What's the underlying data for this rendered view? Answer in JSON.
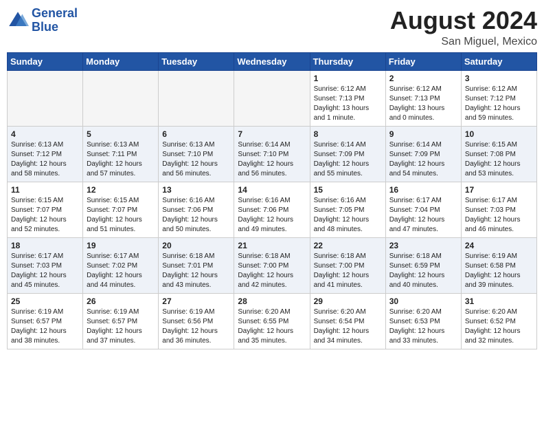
{
  "header": {
    "logo_line1": "General",
    "logo_line2": "Blue",
    "month_year": "August 2024",
    "location": "San Miguel, Mexico"
  },
  "weekdays": [
    "Sunday",
    "Monday",
    "Tuesday",
    "Wednesday",
    "Thursday",
    "Friday",
    "Saturday"
  ],
  "weeks": [
    [
      {
        "day": "",
        "content": ""
      },
      {
        "day": "",
        "content": ""
      },
      {
        "day": "",
        "content": ""
      },
      {
        "day": "",
        "content": ""
      },
      {
        "day": "1",
        "content": "Sunrise: 6:12 AM\nSunset: 7:13 PM\nDaylight: 13 hours\nand 1 minute."
      },
      {
        "day": "2",
        "content": "Sunrise: 6:12 AM\nSunset: 7:13 PM\nDaylight: 13 hours\nand 0 minutes."
      },
      {
        "day": "3",
        "content": "Sunrise: 6:12 AM\nSunset: 7:12 PM\nDaylight: 12 hours\nand 59 minutes."
      }
    ],
    [
      {
        "day": "4",
        "content": "Sunrise: 6:13 AM\nSunset: 7:12 PM\nDaylight: 12 hours\nand 58 minutes."
      },
      {
        "day": "5",
        "content": "Sunrise: 6:13 AM\nSunset: 7:11 PM\nDaylight: 12 hours\nand 57 minutes."
      },
      {
        "day": "6",
        "content": "Sunrise: 6:13 AM\nSunset: 7:10 PM\nDaylight: 12 hours\nand 56 minutes."
      },
      {
        "day": "7",
        "content": "Sunrise: 6:14 AM\nSunset: 7:10 PM\nDaylight: 12 hours\nand 56 minutes."
      },
      {
        "day": "8",
        "content": "Sunrise: 6:14 AM\nSunset: 7:09 PM\nDaylight: 12 hours\nand 55 minutes."
      },
      {
        "day": "9",
        "content": "Sunrise: 6:14 AM\nSunset: 7:09 PM\nDaylight: 12 hours\nand 54 minutes."
      },
      {
        "day": "10",
        "content": "Sunrise: 6:15 AM\nSunset: 7:08 PM\nDaylight: 12 hours\nand 53 minutes."
      }
    ],
    [
      {
        "day": "11",
        "content": "Sunrise: 6:15 AM\nSunset: 7:07 PM\nDaylight: 12 hours\nand 52 minutes."
      },
      {
        "day": "12",
        "content": "Sunrise: 6:15 AM\nSunset: 7:07 PM\nDaylight: 12 hours\nand 51 minutes."
      },
      {
        "day": "13",
        "content": "Sunrise: 6:16 AM\nSunset: 7:06 PM\nDaylight: 12 hours\nand 50 minutes."
      },
      {
        "day": "14",
        "content": "Sunrise: 6:16 AM\nSunset: 7:06 PM\nDaylight: 12 hours\nand 49 minutes."
      },
      {
        "day": "15",
        "content": "Sunrise: 6:16 AM\nSunset: 7:05 PM\nDaylight: 12 hours\nand 48 minutes."
      },
      {
        "day": "16",
        "content": "Sunrise: 6:17 AM\nSunset: 7:04 PM\nDaylight: 12 hours\nand 47 minutes."
      },
      {
        "day": "17",
        "content": "Sunrise: 6:17 AM\nSunset: 7:03 PM\nDaylight: 12 hours\nand 46 minutes."
      }
    ],
    [
      {
        "day": "18",
        "content": "Sunrise: 6:17 AM\nSunset: 7:03 PM\nDaylight: 12 hours\nand 45 minutes."
      },
      {
        "day": "19",
        "content": "Sunrise: 6:17 AM\nSunset: 7:02 PM\nDaylight: 12 hours\nand 44 minutes."
      },
      {
        "day": "20",
        "content": "Sunrise: 6:18 AM\nSunset: 7:01 PM\nDaylight: 12 hours\nand 43 minutes."
      },
      {
        "day": "21",
        "content": "Sunrise: 6:18 AM\nSunset: 7:00 PM\nDaylight: 12 hours\nand 42 minutes."
      },
      {
        "day": "22",
        "content": "Sunrise: 6:18 AM\nSunset: 7:00 PM\nDaylight: 12 hours\nand 41 minutes."
      },
      {
        "day": "23",
        "content": "Sunrise: 6:18 AM\nSunset: 6:59 PM\nDaylight: 12 hours\nand 40 minutes."
      },
      {
        "day": "24",
        "content": "Sunrise: 6:19 AM\nSunset: 6:58 PM\nDaylight: 12 hours\nand 39 minutes."
      }
    ],
    [
      {
        "day": "25",
        "content": "Sunrise: 6:19 AM\nSunset: 6:57 PM\nDaylight: 12 hours\nand 38 minutes."
      },
      {
        "day": "26",
        "content": "Sunrise: 6:19 AM\nSunset: 6:57 PM\nDaylight: 12 hours\nand 37 minutes."
      },
      {
        "day": "27",
        "content": "Sunrise: 6:19 AM\nSunset: 6:56 PM\nDaylight: 12 hours\nand 36 minutes."
      },
      {
        "day": "28",
        "content": "Sunrise: 6:20 AM\nSunset: 6:55 PM\nDaylight: 12 hours\nand 35 minutes."
      },
      {
        "day": "29",
        "content": "Sunrise: 6:20 AM\nSunset: 6:54 PM\nDaylight: 12 hours\nand 34 minutes."
      },
      {
        "day": "30",
        "content": "Sunrise: 6:20 AM\nSunset: 6:53 PM\nDaylight: 12 hours\nand 33 minutes."
      },
      {
        "day": "31",
        "content": "Sunrise: 6:20 AM\nSunset: 6:52 PM\nDaylight: 12 hours\nand 32 minutes."
      }
    ]
  ]
}
